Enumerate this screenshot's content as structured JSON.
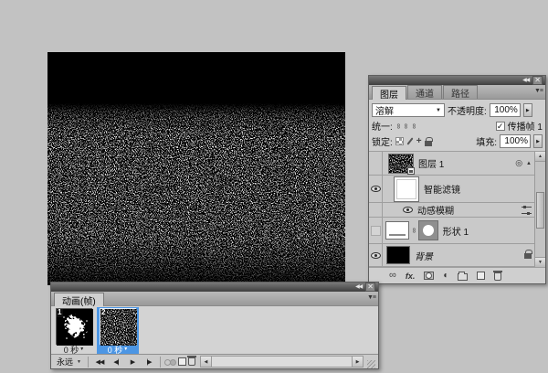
{
  "colors": {
    "desktop_bg": "#c2c2c2",
    "panel_bg": "#cfcfcf",
    "selection_blue": "#4c96e4",
    "canvas_bg": "#000000"
  },
  "icons": {
    "collapse": "◀◀",
    "close": "✕",
    "panel_menu": "▼≡",
    "dropdown": "▼",
    "spinner": "▶",
    "check": "✓",
    "move": "+",
    "link": "∞",
    "fx": "fx.",
    "adjustment": "◐",
    "smart_filter_badge": "◎",
    "collapse_arrow": "▲",
    "first_frame": "◀◀",
    "prev_frame": "◀|",
    "play": "▶",
    "next_frame": "|▶",
    "scroll_left": "◀",
    "scroll_right": "▶",
    "scroll_up": "▲",
    "scroll_down": "▼"
  },
  "layers_panel": {
    "tabs": [
      {
        "label": "图层"
      },
      {
        "label": "通道"
      },
      {
        "label": "路径"
      }
    ],
    "blend_mode_value": "溶解",
    "opacity_label": "不透明度:",
    "opacity_value": "100%",
    "unify_label": "统一:",
    "propagate_frame_label": "传播帧 1",
    "lock_label": "锁定:",
    "fill_label": "填充:",
    "fill_value": "100%",
    "layers": [
      {
        "name": "图层 1"
      },
      {
        "name": "智能滤镜"
      },
      {
        "name": "动感模糊"
      },
      {
        "name": "形状 1"
      },
      {
        "name": "背景"
      }
    ]
  },
  "animation_panel": {
    "tab_label": "动画(帧)",
    "loop_value": "永远",
    "frames": [
      {
        "number": "1",
        "delay": "0 秒"
      },
      {
        "number": "2",
        "delay": "0 秒"
      }
    ]
  }
}
